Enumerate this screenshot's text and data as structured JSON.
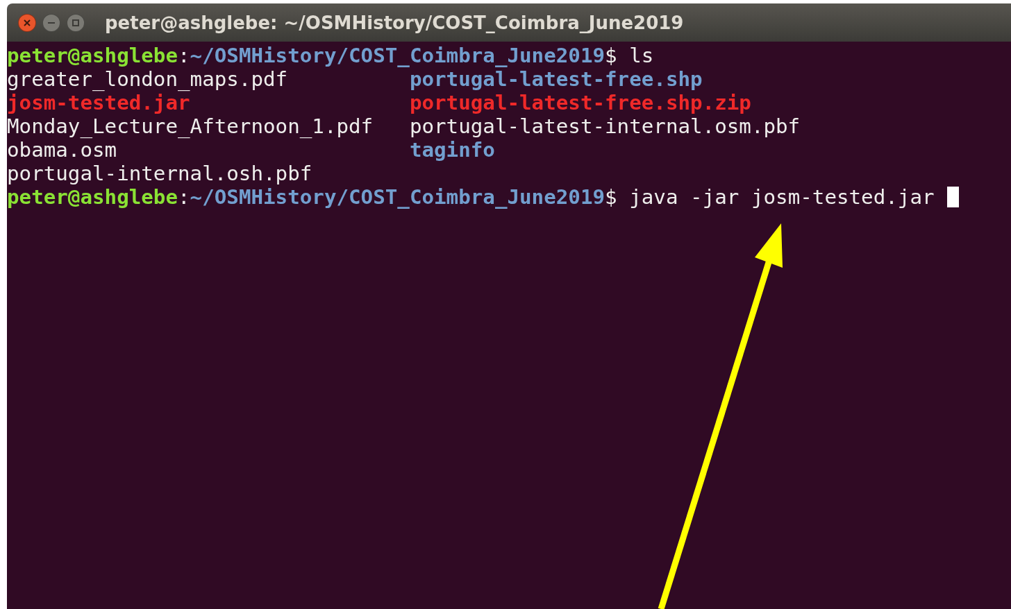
{
  "window": {
    "title": "peter@ashglebe: ~/OSMHistory/COST_Coimbra_June2019"
  },
  "terminal": {
    "blocks": [
      {
        "prompt": {
          "user": "peter@ashglebe",
          "separator": ":",
          "path": "~/OSMHistory/COST_Coimbra_June2019",
          "symbol": "$",
          "command": "ls"
        },
        "listing": [
          [
            {
              "name": "greater_london_maps.pdf",
              "kind": "file"
            },
            {
              "name": "josm-tested.jar",
              "kind": "archive"
            },
            {
              "name": "Monday_Lecture_Afternoon_1.pdf",
              "kind": "file"
            },
            {
              "name": "obama.osm",
              "kind": "file"
            },
            {
              "name": "portugal-internal.osh.pbf",
              "kind": "file"
            }
          ],
          [
            {
              "name": "portugal-latest-free.shp",
              "kind": "directory"
            },
            {
              "name": "portugal-latest-free.shp.zip",
              "kind": "archive"
            },
            {
              "name": "portugal-latest-internal.osm.pbf",
              "kind": "file"
            },
            {
              "name": "taginfo",
              "kind": "directory"
            }
          ]
        ]
      },
      {
        "prompt": {
          "user": "peter@ashglebe",
          "separator": ":",
          "path": "~/OSMHistory/COST_Coimbra_June2019",
          "symbol": "$",
          "command": "java -jar josm-tested.jar"
        }
      }
    ]
  }
}
